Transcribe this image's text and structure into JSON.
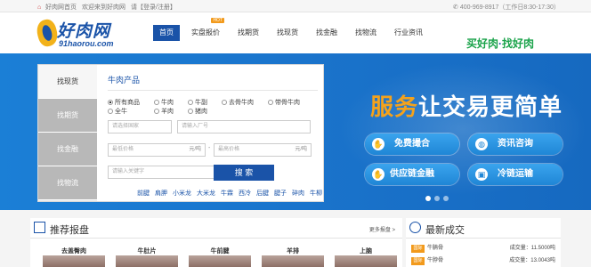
{
  "topbar": {
    "home": "好肉网首页",
    "welcome": "欢迎来到好肉网",
    "login_prompt": "请【登录/注册】",
    "hotline": "400-969-8917（工作日8:30-17:30）"
  },
  "logo": {
    "cn": "好肉网",
    "en": "91haorou.com"
  },
  "nav": {
    "items": [
      {
        "label": "首页",
        "active": true,
        "badge": ""
      },
      {
        "label": "实盘报价",
        "active": false,
        "badge": "HOT"
      },
      {
        "label": "找期货",
        "active": false,
        "badge": ""
      },
      {
        "label": "找现货",
        "active": false,
        "badge": ""
      },
      {
        "label": "找金融",
        "active": false,
        "badge": ""
      },
      {
        "label": "找物流",
        "active": false,
        "badge": ""
      },
      {
        "label": "行业资讯",
        "active": false,
        "badge": ""
      }
    ]
  },
  "slogan": {
    "part1": "买好肉",
    "dot": "·",
    "part2": "找好肉"
  },
  "search_panel": {
    "tabs": [
      "找现货",
      "找期货",
      "找金融",
      "找物流"
    ],
    "active_tab": "找现货",
    "title": "牛肉产品",
    "radios_row1": [
      "所有商品",
      "牛肉",
      "牛副",
      "去骨牛肉",
      "带骨牛肉"
    ],
    "radios_row2": [
      "全牛",
      "羊肉",
      "猪肉"
    ],
    "selected": "所有商品",
    "country_placeholder": "请选择国家",
    "factory_placeholder": "请输入厂号",
    "min_price_placeholder": "最低价格",
    "max_price_placeholder": "最高价格",
    "unit": "元/吨",
    "separator": "-",
    "keyword_placeholder": "请输入关键字",
    "search_label": "搜 索",
    "tags": [
      "前腱",
      "肩胛",
      "小米龙",
      "大米龙",
      "牛霖",
      "西冷",
      "后腱",
      "腱子",
      "碎肉",
      "牛柳"
    ]
  },
  "banner": {
    "headline_accent": "服务",
    "headline_rest": "让交易更简单",
    "buttons": [
      {
        "label": "免费撮合",
        "icon": "handshake-icon"
      },
      {
        "label": "资讯咨询",
        "icon": "globe-icon"
      },
      {
        "label": "供应链金融",
        "icon": "handshake-icon"
      },
      {
        "label": "冷链运输",
        "icon": "truck-icon"
      }
    ]
  },
  "recommend": {
    "title": "推荐报盘",
    "more": "更多报盘 >",
    "products": [
      "去盖臀肉",
      "牛肚片",
      "牛前腱",
      "羊排",
      "上脑"
    ]
  },
  "latest_deals": {
    "title": "最新成交",
    "rows": [
      {
        "tag": "国际",
        "name": "牛腩骨",
        "qty_label": "成交量：",
        "qty": "11.5000吨"
      },
      {
        "tag": "国际",
        "name": "牛脖骨",
        "qty_label": "成交量：",
        "qty": "13.0043吨"
      }
    ]
  }
}
